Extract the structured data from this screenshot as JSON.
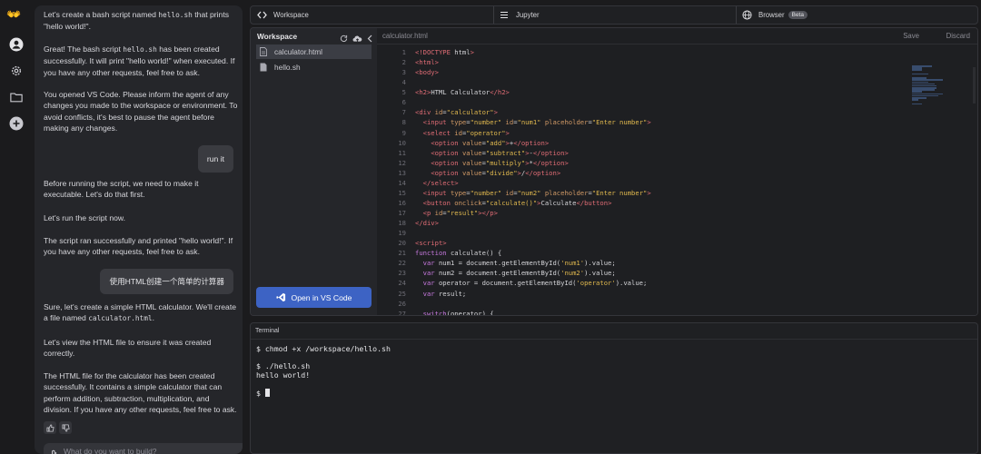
{
  "app": {
    "logo_glyph": "👐",
    "accent": "#3d63c4"
  },
  "rail": {
    "icons": [
      "user-icon",
      "gear-icon",
      "folder-icon",
      "plus-icon"
    ]
  },
  "chat": {
    "messages": [
      {
        "role": "agent",
        "parts": [
          "Let's create a bash script named ",
          "hello.sh",
          " that prints \"hello world!\"."
        ]
      },
      {
        "role": "agent",
        "parts": [
          "Great! The bash script ",
          "hello.sh",
          " has been created successfully. It will print \"hello world!\" when executed. If you have any other requests, feel free to ask."
        ]
      },
      {
        "role": "agent",
        "text": "You opened VS Code. Please inform the agent of any changes you made to the workspace or environment. To avoid conflicts, it's best to pause the agent before making any changes."
      },
      {
        "role": "user",
        "text": "run it"
      },
      {
        "role": "agent",
        "text": "Before running the script, we need to make it executable. Let's do that first."
      },
      {
        "role": "agent",
        "text": "Let's run the script now."
      },
      {
        "role": "agent",
        "text": "The script ran successfully and printed \"hello world!\". If you have any other requests, feel free to ask."
      },
      {
        "role": "user",
        "text": "使用HTML创建一个简单的计算器"
      },
      {
        "role": "agent",
        "parts": [
          "Sure, let's create a simple HTML calculator. We'll create a file named ",
          "calculator.html",
          "."
        ]
      },
      {
        "role": "agent",
        "text": "Let's view the HTML file to ensure it was created correctly."
      },
      {
        "role": "agent",
        "text": "The HTML file for the calculator has been created successfully. It contains a simple calculator that can perform addition, subtraction, multiplication, and division. If you have any other requests, feel free to ask."
      }
    ],
    "input_placeholder": "What do you want to build?"
  },
  "tabs": {
    "workspace": "Workspace",
    "jupyter": "Jupyter",
    "browser": "Browser",
    "browser_badge": "Beta"
  },
  "workspace": {
    "title": "Workspace",
    "files": [
      {
        "name": "calculator.html",
        "active": true,
        "icon": "html-file-icon"
      },
      {
        "name": "hello.sh",
        "active": false,
        "icon": "file-icon"
      }
    ],
    "open_vscode": "Open in VS Code"
  },
  "editor": {
    "filename": "calculator.html",
    "save": "Save",
    "discard": "Discard",
    "lines": [
      "<!DOCTYPE html>",
      "<html>",
      "<body>",
      "",
      "<h2>HTML Calculator</h2>",
      "",
      "<div id=\"calculator\">",
      "  <input type=\"number\" id=\"num1\" placeholder=\"Enter number\">",
      "  <select id=\"operator\">",
      "    <option value=\"add\">+</option>",
      "    <option value=\"subtract\">-</option>",
      "    <option value=\"multiply\">*</option>",
      "    <option value=\"divide\">/</option>",
      "  </select>",
      "  <input type=\"number\" id=\"num2\" placeholder=\"Enter number\">",
      "  <button onclick=\"calculate()\">Calculate</button>",
      "  <p id=\"result\"></p>",
      "</div>",
      "",
      "<script>",
      "function calculate() {",
      "  var num1 = document.getElementById('num1').value;",
      "  var num2 = document.getElementById('num2').value;",
      "  var operator = document.getElementById('operator').value;",
      "  var result;",
      "",
      "  switch(operator) {"
    ]
  },
  "terminal": {
    "title": "Terminal",
    "lines": [
      "$ chmod +x /workspace/hello.sh",
      "",
      "$ ./hello.sh",
      "hello world!",
      "",
      "$ "
    ]
  }
}
